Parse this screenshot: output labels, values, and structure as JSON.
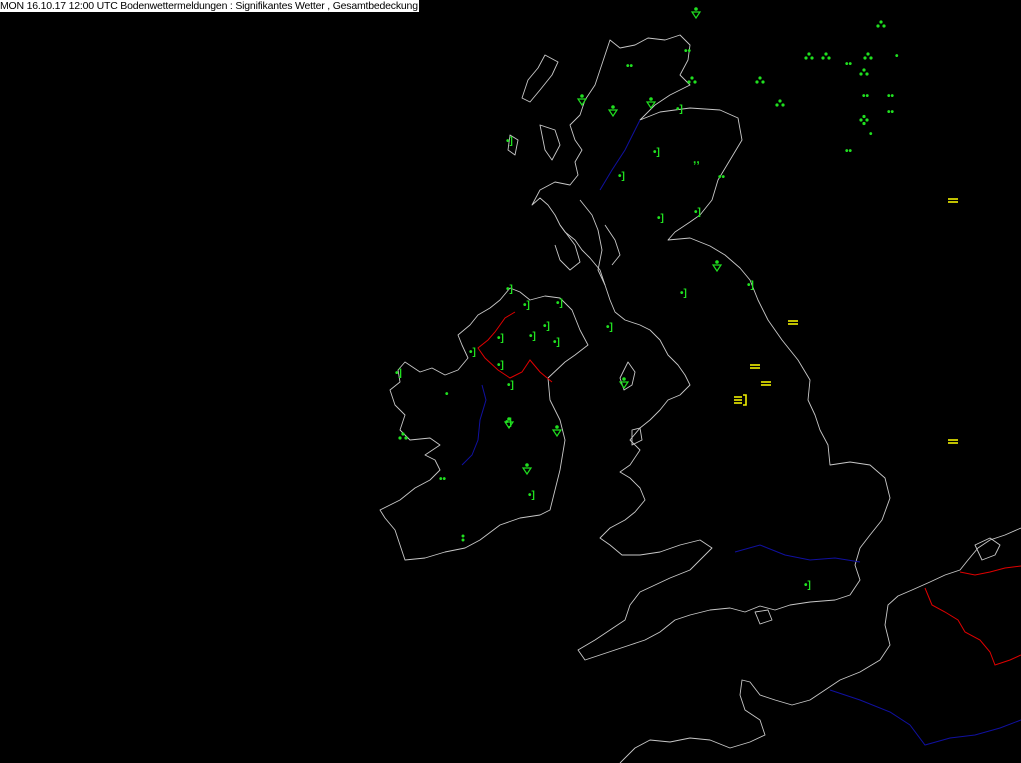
{
  "header": {
    "title": "MON 16.10.17 12:00 UTC  Bodenwettermeldungen :  Signifikantes Wetter , Gesamtbedeckung"
  },
  "colors": {
    "background": "#000000",
    "coastline": "#c8c8c8",
    "border": "#e00000",
    "river": "#1010a0",
    "precip_symbol": "#20e020",
    "fog_symbol": "#f0f000"
  },
  "symbol_legend": {
    "rain": "•",
    "rain_continuous": "••",
    "rain_shower": "rain-shower-triangle",
    "drizzle": ",,",
    "rain_recent": "•]",
    "fog": "≡",
    "fog_recent": "≡]"
  }
}
